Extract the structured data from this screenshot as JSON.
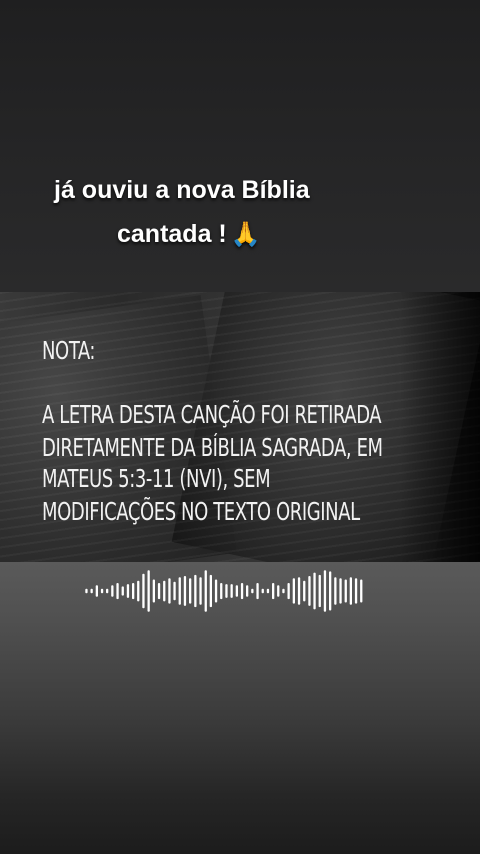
{
  "caption": {
    "line1": "já ouviu a nova Bíblia",
    "line2": "cantada !",
    "emoji": "🙏"
  },
  "note": {
    "title": "NOTA:",
    "lines": [
      "A LETRA DESTA CANÇÃO FOI RETIRADA",
      "DIRETAMENTE DA BÍBLIA SAGRADA, EM",
      "MATEUS 5:3-11 (NVI), SEM",
      "MODIFICAÇÕES NO TEXTO ORIGINAL"
    ]
  },
  "waveform": {
    "color": "#ffffff",
    "levels": [
      0.1,
      0.1,
      0.25,
      0.1,
      0.1,
      0.25,
      0.35,
      0.2,
      0.3,
      0.35,
      0.45,
      0.75,
      0.9,
      0.5,
      0.35,
      0.45,
      0.55,
      0.4,
      0.6,
      0.65,
      0.55,
      0.7,
      0.6,
      0.9,
      0.7,
      0.5,
      0.35,
      0.3,
      0.3,
      0.25,
      0.35,
      0.25,
      0.1,
      0.35,
      0.1,
      0.1,
      0.35,
      0.25,
      0.1,
      0.35,
      0.55,
      0.6,
      0.45,
      0.65,
      0.8,
      0.7,
      0.9,
      0.85,
      0.6,
      0.55,
      0.5,
      0.6,
      0.55,
      0.5
    ]
  }
}
